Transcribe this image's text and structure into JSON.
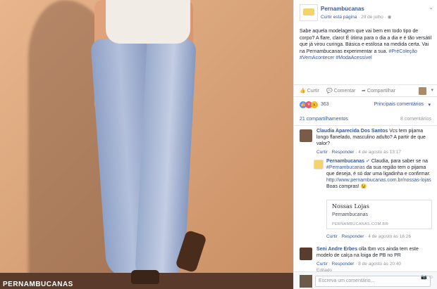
{
  "photo": {
    "brand_text": "PERNAMBUCANAS"
  },
  "post": {
    "page_name": "Pernambucanas",
    "meta_prefix": "Curtir esta página",
    "meta_sep": " · ",
    "date": "29 de julho",
    "meta_suffix": " · ",
    "text": "Sabe aquela modelagem que vai bem em todo tipo de corpo? A flare, claro! É ótima para o dia a dia e é tão versátil que já virou curinga. Básica e estilosa na medida certa. Vai na Pernambucanas experimentar a sua.",
    "hashtags": " #PréColeção #VemAcontecer #ModaAcessível"
  },
  "actions": {
    "like": "Curtir",
    "comment": "Comentar",
    "share": "Compartilhar"
  },
  "reactions": {
    "count": "363",
    "top_comments": "Principais comentários"
  },
  "stats": {
    "shares": "21 compartilhamentos",
    "comments": "8 comentários"
  },
  "comments": [
    {
      "name": "Claudia Aparecida Dos Santos",
      "text": "Vcs tem pijama longo flanelado, masculino adulto? A partir de que valor?",
      "like": "Curtir",
      "reply": "Responder",
      "date": "4 de agosto às 13:17"
    },
    {
      "name": "Pernambucanas",
      "text_before": " Claudia, para saber se na ",
      "hashtag": "#Pernambucanas",
      "text_after": " da sua região tem o pijama que deseja, é só dar uma ligadinha e confirmar.",
      "link": "http://www.pernambucanas.com.br/nossas-lojas",
      "text_end": " Boas compras! 😉",
      "preview_title": "Nossas Lojas",
      "preview_sub": "Pernambucanas",
      "preview_domain": "PERNAMBUCANAS.COM.BR",
      "like": "Curtir",
      "reply": "Responder",
      "date": "4 de agosto às 16:26"
    },
    {
      "name": "Seni Andre Erbes",
      "text": "olla tbm vcs ainda tem este modelo de calça na loiga de PB no PR",
      "like": "Curtir",
      "reply": "Responder",
      "date": "8 de agosto às 20:40",
      "edited": "Editado"
    }
  ],
  "write": {
    "placeholder": "Escreva um comentário..."
  },
  "colors": {
    "link": "#365899",
    "muted": "#90949c",
    "like_blue": "#5890ff",
    "love_red": "#f25268",
    "wow_yellow": "#f7b125"
  },
  "icons": {
    "like": "thumbs-up-icon",
    "comment": "speech-bubble-icon",
    "share": "share-arrow-icon",
    "camera": "camera-icon",
    "emoji": "emoji-icon",
    "caret": "chevron-down-icon",
    "verified": "verified-badge-icon"
  }
}
